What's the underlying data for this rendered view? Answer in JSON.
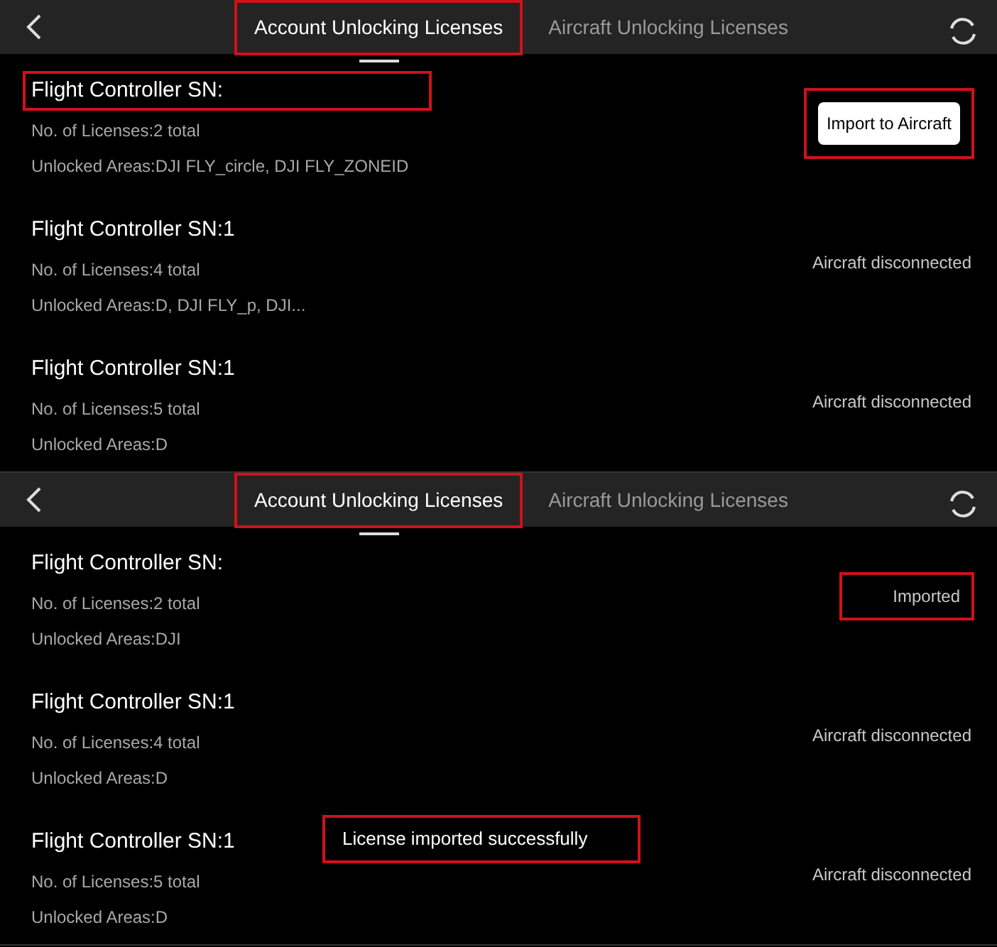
{
  "screens": [
    {
      "tabs": [
        {
          "label": "Account Unlocking Licenses",
          "selected": true,
          "highlighted": true
        },
        {
          "label": "Aircraft Unlocking Licenses",
          "selected": false,
          "highlighted": false
        }
      ],
      "licenses": [
        {
          "title": "Flight Controller SN:",
          "title_highlighted": true,
          "count": "No. of Licenses:2 total",
          "areas": "Unlocked Areas:DJI FLY_circle, DJI FLY_ZONEID",
          "action": {
            "kind": "button",
            "label": "Import to Aircraft",
            "highlighted": true
          }
        },
        {
          "title": "Flight Controller SN:1",
          "title_highlighted": false,
          "count": "No. of Licenses:4 total",
          "areas": "Unlocked Areas:D, DJI FLY_p, DJI...",
          "action": {
            "kind": "status",
            "label": "Aircraft disconnected",
            "highlighted": false
          }
        },
        {
          "title": "Flight Controller SN:1",
          "title_highlighted": false,
          "count": "No. of Licenses:5 total",
          "areas": "Unlocked Areas:D",
          "action": {
            "kind": "status",
            "label": "Aircraft disconnected",
            "highlighted": false
          }
        }
      ]
    },
    {
      "tabs": [
        {
          "label": "Account Unlocking Licenses",
          "selected": true,
          "highlighted": true
        },
        {
          "label": "Aircraft Unlocking Licenses",
          "selected": false,
          "highlighted": false
        }
      ],
      "licenses": [
        {
          "title": "Flight Controller SN:",
          "title_highlighted": false,
          "count": "No. of Licenses:2 total",
          "areas": "Unlocked Areas:DJI",
          "action": {
            "kind": "status",
            "label": "Imported",
            "highlighted": true
          }
        },
        {
          "title": "Flight Controller SN:1",
          "title_highlighted": false,
          "count": "No. of Licenses:4 total",
          "areas": "Unlocked Areas:D",
          "action": {
            "kind": "status",
            "label": "Aircraft disconnected",
            "highlighted": false
          }
        },
        {
          "title": "Flight Controller SN:1",
          "title_highlighted": false,
          "count": "No. of Licenses:5 total",
          "areas": "Unlocked Areas:D",
          "action": {
            "kind": "status",
            "label": "Aircraft disconnected",
            "highlighted": false
          }
        }
      ],
      "toast": {
        "text": "License imported successfully",
        "highlighted": true
      }
    }
  ]
}
